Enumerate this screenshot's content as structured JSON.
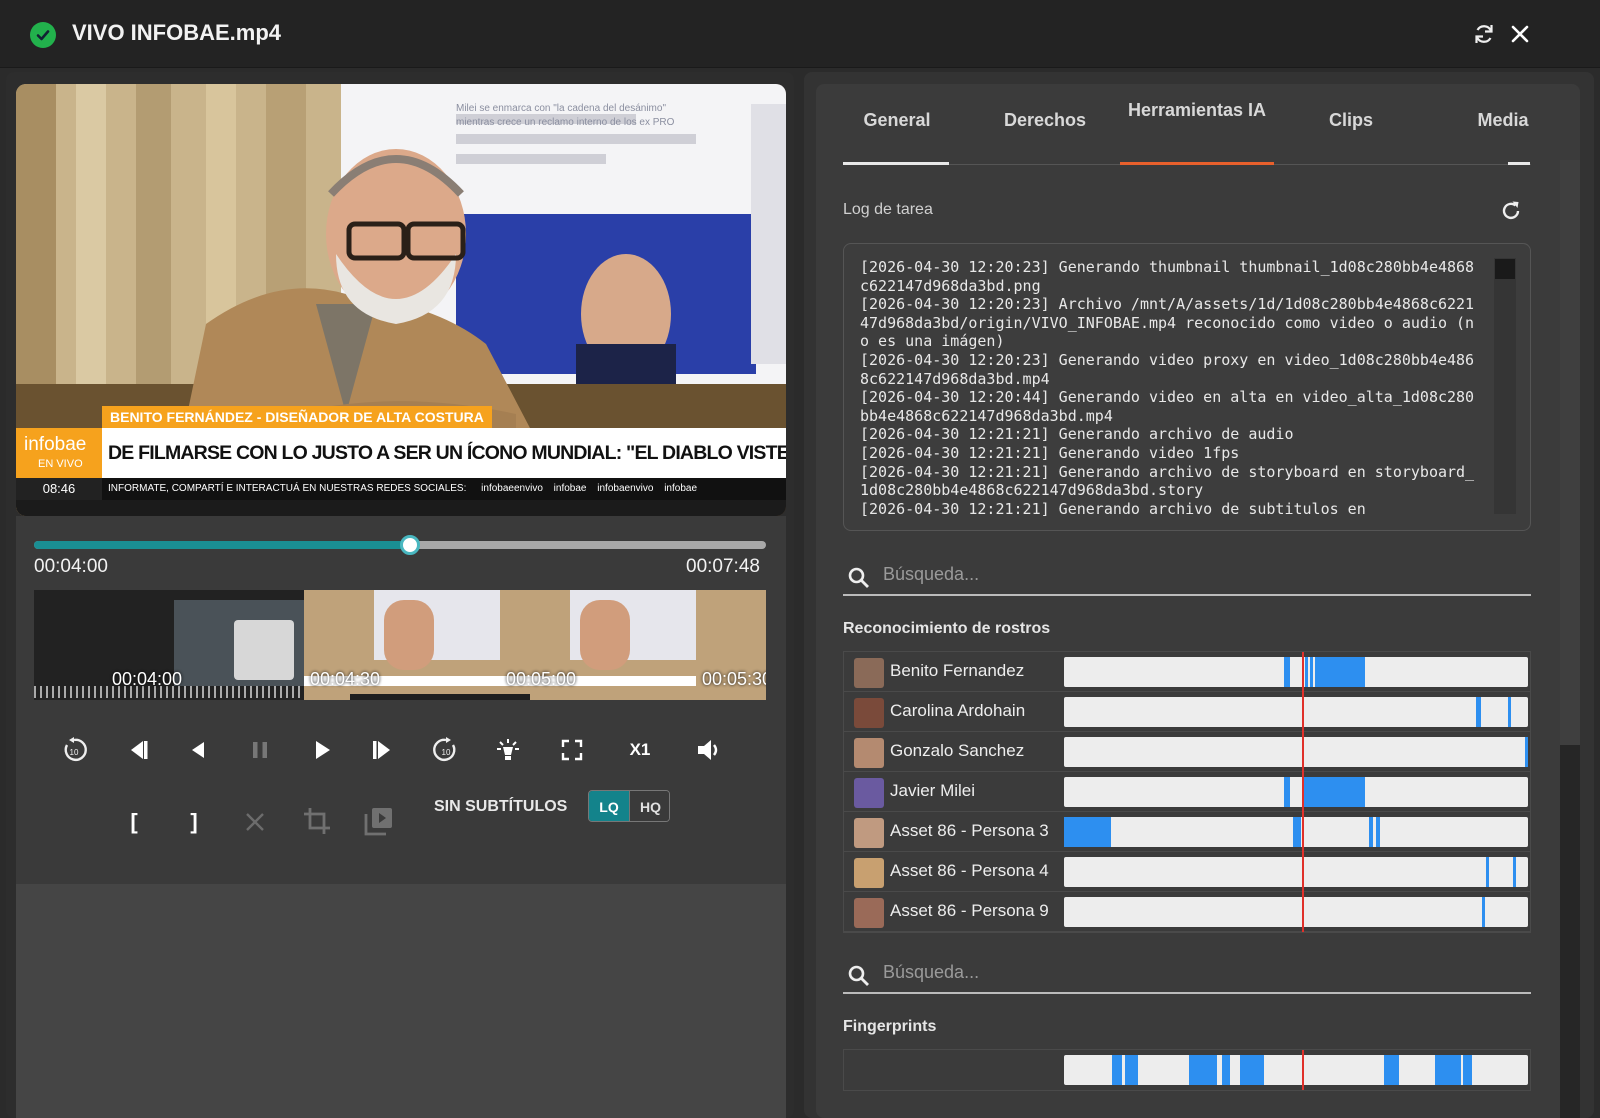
{
  "window": {
    "title": "VIVO INFOBAE.mp4"
  },
  "player": {
    "overlay": {
      "lower_third_name": "BENITO FERNÁNDEZ - DISEÑADOR DE ALTA COSTURA",
      "headline": "DE FILMARSE CON LO JUSTO A SER UN ÍCONO MUNDIAL: \"EL DIABLO VISTE A LA MODA\"",
      "ticker": "INFORMATE, COMPARTÍ E INTERACTUÁ EN NUESTRAS REDES SOCIALES:",
      "ticker_handles": [
        "infobaeenvivo",
        "infobae",
        "infobaenvivo",
        "infobae"
      ],
      "brand": "infobae",
      "brand_sub": "EN VIVO",
      "clock": "08:46",
      "screen_text": "Milei se enmarca con \"la cadena del desánimo\" mientras crece un reclamo interno de los ex PRO"
    },
    "progress": {
      "current": "00:04:00",
      "total": "00:07:48",
      "fraction": 0.513
    },
    "thumbnails": [
      "00:04:00",
      "00:04:30",
      "00:05:00",
      "00:05:30"
    ],
    "controls": {
      "speed": "X1",
      "subtitles": "SIN SUBTÍTULOS",
      "quality_lq": "LQ",
      "quality_hq": "HQ",
      "mark_in": "[",
      "mark_out": "]"
    }
  },
  "tabs": [
    {
      "label": "General"
    },
    {
      "label": "Derechos"
    },
    {
      "label": "Herramientas IA",
      "active": true
    },
    {
      "label": "Clips"
    },
    {
      "label": "Media"
    }
  ],
  "log": {
    "label": "Log de tarea",
    "text": "[2026-04-30 12:20:23] Generando thumbnail thumbnail_1d08c280bb4e4868c622147d968da3bd.png\n[2026-04-30 12:20:23] Archivo /mnt/A/assets/1d/1d08c280bb4e4868c622147d968da3bd/origin/VIVO_INFOBAE.mp4 reconocido como video o audio (no es una imágen)\n[2026-04-30 12:20:23] Generando video proxy en video_1d08c280bb4e4868c622147d968da3bd.mp4\n[2026-04-30 12:20:44] Generando video en alta en video_alta_1d08c280bb4e4868c622147d968da3bd.mp4\n[2026-04-30 12:21:21] Generando archivo de audio\n[2026-04-30 12:21:21] Generando video 1fps\n[2026-04-30 12:21:21] Generando archivo de storyboard en storyboard_1d08c280bb4e4868c622147d968da3bd.story\n[2026-04-30 12:21:21] Generando archivo de subtitulos en"
  },
  "faces": {
    "search_placeholder": "Búsqueda...",
    "label": "Reconocimiento de rostros",
    "playhead_fraction": 0.513,
    "rows": [
      {
        "name": "Benito Fernandez",
        "segments": [
          [
            0.475,
            0.487
          ],
          [
            0.52,
            0.524
          ],
          [
            0.53,
            0.535
          ],
          [
            0.54,
            0.648
          ]
        ]
      },
      {
        "name": "Carolina Ardohain",
        "segments": [
          [
            0.888,
            0.898
          ],
          [
            0.957,
            0.962
          ]
        ]
      },
      {
        "name": "Gonzalo Sanchez",
        "segments": [
          [
            0.993,
            1.0
          ]
        ]
      },
      {
        "name": "Javier Milei",
        "segments": [
          [
            0.475,
            0.487
          ],
          [
            0.516,
            0.648
          ]
        ]
      },
      {
        "name": "Asset 86 - Persona 3",
        "segments": [
          [
            0.0,
            0.102
          ],
          [
            0.493,
            0.51
          ],
          [
            0.658,
            0.666
          ],
          [
            0.673,
            0.682
          ]
        ]
      },
      {
        "name": "Asset 86 - Persona 4",
        "segments": [
          [
            0.91,
            0.916
          ],
          [
            0.967,
            0.972
          ]
        ]
      },
      {
        "name": "Asset 86 - Persona 9",
        "segments": [
          [
            0.9,
            0.906
          ]
        ]
      }
    ]
  },
  "fingerprints": {
    "search_placeholder": "Búsqueda...",
    "label": "Fingerprints",
    "playhead_fraction": 0.513,
    "segments": [
      [
        0.103,
        0.125
      ],
      [
        0.132,
        0.16
      ],
      [
        0.27,
        0.33
      ],
      [
        0.34,
        0.358
      ],
      [
        0.38,
        0.43
      ],
      [
        0.69,
        0.722
      ],
      [
        0.8,
        0.855
      ],
      [
        0.86,
        0.88
      ]
    ]
  }
}
